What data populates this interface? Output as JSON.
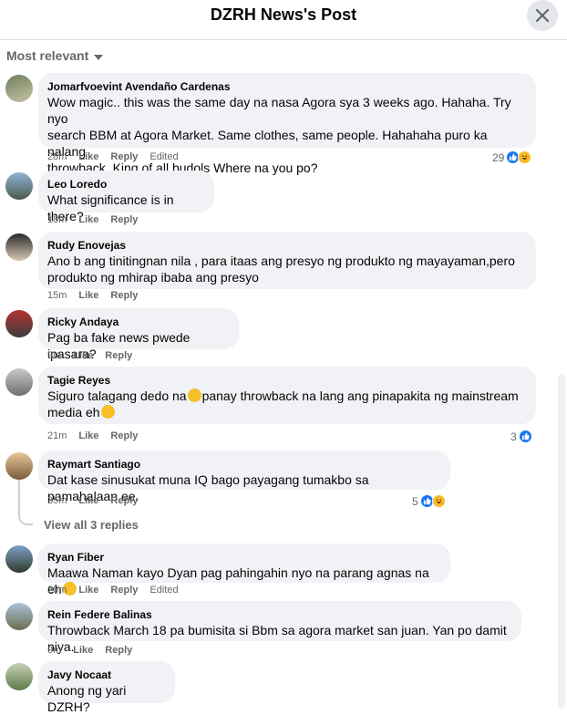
{
  "header": {
    "title": "DZRH News's Post"
  },
  "sort": {
    "label": "Most relevant"
  },
  "actions": {
    "like": "Like",
    "reply": "Reply",
    "edited": "Edited"
  },
  "comments": [
    {
      "name": "Jomarfvoevint Avendaño Cardenas",
      "lines": [
        "Wow magic.. this was the same day na nasa Agora sya 3 weeks ago. Hahaha. Try nyo",
        "search BBM at Agora Market. Same clothes, same people. Hahahaha puro ka nalang",
        "throwback. King of all budols Where na you po?"
      ],
      "time": "28m",
      "edited": true,
      "reactions": "29"
    },
    {
      "name": "Leo Loredo",
      "lines": [
        "What significance is in there?"
      ],
      "time": "18m"
    },
    {
      "name": "Rudy Enovejas",
      "lines": [
        "Ano b ang tinitingnan nila , para itaas ang presyo ng produkto ng mayayaman,pero",
        "produkto ng mhirap ibaba ang presyo"
      ],
      "time": "15m"
    },
    {
      "name": "Ricky Andaya",
      "lines": [
        "Pag ba fake news pwede ipasara?"
      ],
      "time": "9m"
    },
    {
      "name": "Tagie Reyes",
      "line1a": "Siguro talagang dedo na",
      "line1b": "panay throwback na lang ang pinapakita ng mainstream",
      "line2": "media eh",
      "time": "21m",
      "reactions": "3"
    },
    {
      "name": "Raymart Santiago",
      "lines": [
        "Dat kase sinusukat muna IQ bago payagang tumakbo sa pamahalaan ee."
      ],
      "time": "35m",
      "reactions": "5"
    },
    {
      "name": "Ryan Fiber",
      "line1": "Maawa Naman kayo Dyan pag pahingahin nyo na parang agnas na eh",
      "time": "20m",
      "edited": true
    },
    {
      "name": "Rein Federe Balinas",
      "lines": [
        "Throwback March 18 pa bumisita si Bbm sa agora market san juan. Yan po damit niya."
      ],
      "time": "9m"
    },
    {
      "name": "Javy Nocaat",
      "lines": [
        "Anong ng yari DZRH?"
      ]
    }
  ],
  "view_replies": "View all 3 replies",
  "colors": {
    "like": "#1877f2",
    "haha": "#f7b928",
    "bubble": "#f0f2f5"
  }
}
